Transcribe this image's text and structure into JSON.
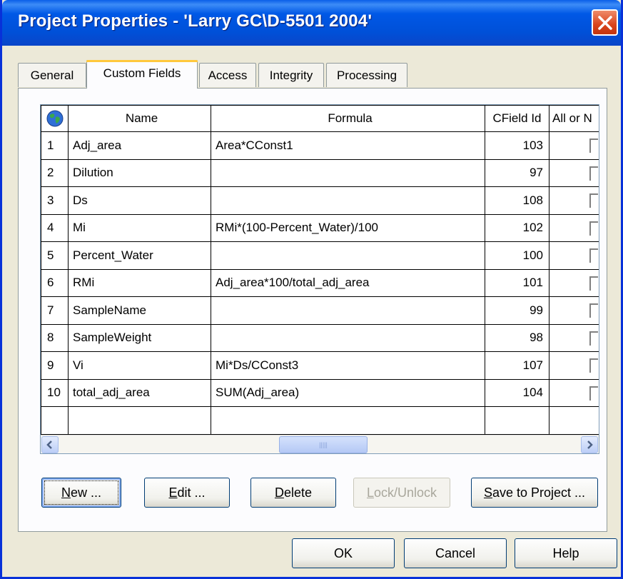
{
  "window": {
    "title": "Project Properties - 'Larry GC\\D-5501 2004'"
  },
  "tabs": [
    {
      "label": "General"
    },
    {
      "label": "Custom Fields"
    },
    {
      "label": "Access"
    },
    {
      "label": "Integrity"
    },
    {
      "label": "Processing"
    }
  ],
  "grid": {
    "headers": {
      "name": "Name",
      "formula": "Formula",
      "cfield_id": "CField Id",
      "all_or": "All or N"
    },
    "rows": [
      {
        "num": "1",
        "name": "Adj_area",
        "formula": "Area*CConst1",
        "cfield_id": "103"
      },
      {
        "num": "2",
        "name": "Dilution",
        "formula": "",
        "cfield_id": "97"
      },
      {
        "num": "3",
        "name": "Ds",
        "formula": "",
        "cfield_id": "108"
      },
      {
        "num": "4",
        "name": "Mi",
        "formula": "RMi*(100-Percent_Water)/100",
        "cfield_id": "102"
      },
      {
        "num": "5",
        "name": "Percent_Water",
        "formula": "",
        "cfield_id": "100"
      },
      {
        "num": "6",
        "name": "RMi",
        "formula": "Adj_area*100/total_adj_area",
        "cfield_id": "101"
      },
      {
        "num": "7",
        "name": "SampleName",
        "formula": "",
        "cfield_id": "99"
      },
      {
        "num": "8",
        "name": "SampleWeight",
        "formula": "",
        "cfield_id": "98"
      },
      {
        "num": "9",
        "name": "Vi",
        "formula": "Mi*Ds/CConst3",
        "cfield_id": "107"
      },
      {
        "num": "10",
        "name": "total_adj_area",
        "formula": "SUM(Adj_area)",
        "cfield_id": "104"
      }
    ]
  },
  "actions": {
    "new": {
      "key": "N",
      "rest": "ew ..."
    },
    "edit": {
      "key": "E",
      "rest": "dit ..."
    },
    "delete": {
      "key": "D",
      "rest": "elete"
    },
    "lock": {
      "key": "L",
      "rest": "ock/Unlock"
    },
    "save": {
      "key": "S",
      "rest": "ave to Project ..."
    }
  },
  "footer": {
    "ok": "OK",
    "cancel": "Cancel",
    "help": "Help"
  },
  "colors": {
    "titlebar": "#0058e6",
    "close": "#d9441c",
    "active_tab_highlight": "#ffc83c"
  }
}
